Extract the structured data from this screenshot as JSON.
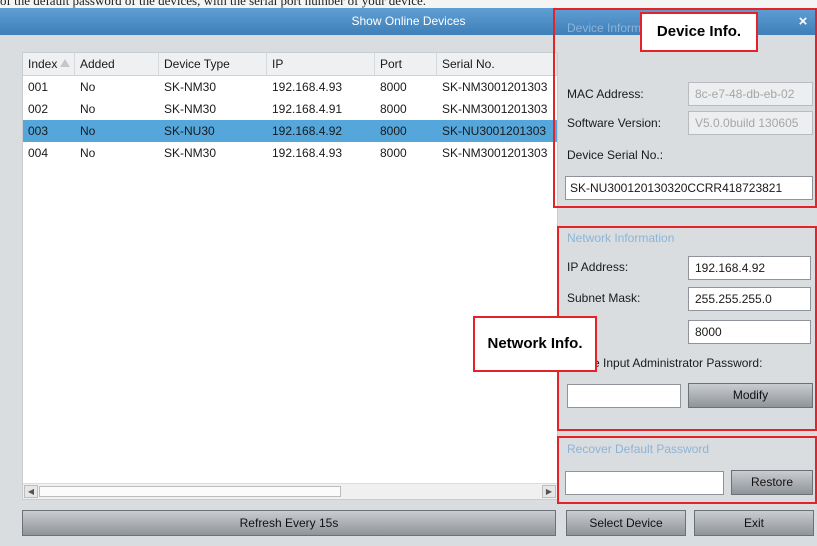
{
  "top_strip_text": "of the default password of the devices, with the serial port number of your device.",
  "window": {
    "title": "Show Online Devices",
    "close_glyph": "×"
  },
  "table": {
    "columns": [
      "Index",
      "Added",
      "Device Type",
      "IP",
      "Port",
      "Serial No."
    ],
    "rows": [
      [
        "001",
        "No",
        "SK-NM30",
        "192.168.4.93",
        "8000",
        "SK-NM3001201303"
      ],
      [
        "002",
        "No",
        "SK-NM30",
        "192.168.4.91",
        "8000",
        "SK-NM3001201303"
      ],
      [
        "003",
        "No",
        "SK-NU30",
        "192.168.4.92",
        "8000",
        "SK-NU3001201303"
      ],
      [
        "004",
        "No",
        "SK-NM30",
        "192.168.4.93",
        "8000",
        "SK-NM3001201303"
      ]
    ],
    "selected_row_index": 2,
    "scroll_left_glyph": "◀",
    "scroll_right_glyph": "▶"
  },
  "buttons": {
    "refresh": "Refresh Every 15s",
    "select_device": "Select Device",
    "exit": "Exit",
    "modify": "Modify",
    "restore": "Restore"
  },
  "device_info": {
    "group_label": "Device Inform",
    "mac_label": "MAC Address:",
    "mac_value": "8c-e7-48-db-eb-02",
    "software_label": "Software Version:",
    "software_value": "V5.0.0build 130605",
    "serial_label": "Device Serial No.:",
    "serial_value": "SK-NU300120130320CCRR418723821"
  },
  "network_info": {
    "group_label": "Network Information",
    "ip_label": "IP Address:",
    "ip_value": "192.168.4.92",
    "mask_label": "Subnet Mask:",
    "mask_value": "255.255.255.0",
    "port_value": "8000",
    "password_prompt": "e Input Administrator Password:",
    "password_value": ""
  },
  "recover": {
    "group_label": "Recover Default Password",
    "input_value": ""
  },
  "callouts": {
    "device": "Device Info.",
    "network": "Network Info."
  },
  "colors": {
    "titlebar": "#4b8cc4",
    "selected_row": "#55a6da",
    "highlight": "#e32327"
  }
}
